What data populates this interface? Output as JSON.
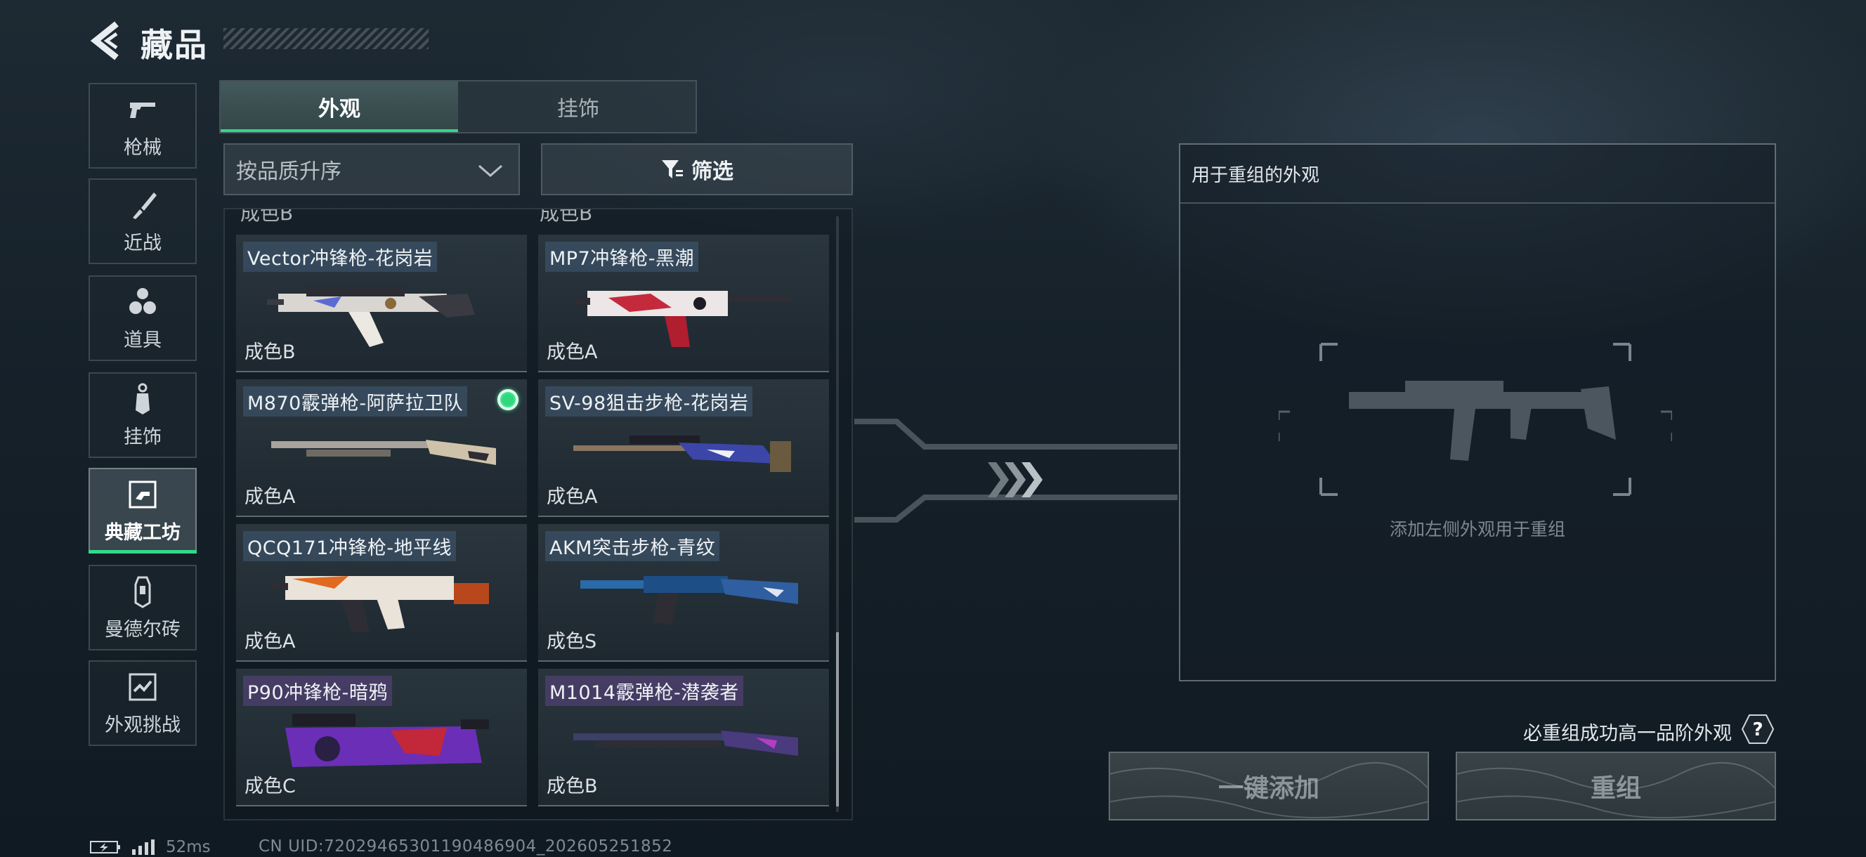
{
  "header": {
    "title": "藏品"
  },
  "categories": [
    {
      "label": "枪械",
      "icon": "pistol-icon",
      "active": false
    },
    {
      "label": "近战",
      "icon": "knife-icon",
      "active": false
    },
    {
      "label": "道具",
      "icon": "grenades-icon",
      "active": false
    },
    {
      "label": "挂饰",
      "icon": "charm-icon",
      "active": false
    },
    {
      "label": "典藏工坊",
      "icon": "workshop-icon",
      "active": true
    },
    {
      "label": "曼德尔砖",
      "icon": "mandel-brick-icon",
      "active": false
    },
    {
      "label": "外观挑战",
      "icon": "challenge-icon",
      "active": false
    }
  ],
  "tabs": [
    {
      "label": "外观",
      "active": true
    },
    {
      "label": "挂饰",
      "active": false
    }
  ],
  "sort": {
    "value": "按品质升序"
  },
  "filter": {
    "label": "筛选",
    "icon": "filter-icon"
  },
  "items": [
    {
      "name": "Vector冲锋枪-花岗岩",
      "grade": "成色B",
      "equipped": false,
      "tint": "blue"
    },
    {
      "name": "MP7冲锋枪-黑潮",
      "grade": "成色A",
      "equipped": false,
      "tint": "blue"
    },
    {
      "name": "M870霰弹枪-阿萨拉卫队",
      "grade": "成色A",
      "equipped": true,
      "tint": "blue"
    },
    {
      "name": "SV-98狙击步枪-花岗岩",
      "grade": "成色A",
      "equipped": false,
      "tint": "blue"
    },
    {
      "name": "QCQ171冲锋枪-地平线",
      "grade": "成色A",
      "equipped": false,
      "tint": "blue"
    },
    {
      "name": "AKM突击步枪-青纹",
      "grade": "成色S",
      "equipped": false,
      "tint": "blue"
    },
    {
      "name": "P90冲锋枪-暗鸦",
      "grade": "成色C",
      "equipped": false,
      "tint": "purple"
    },
    {
      "name": "M1014霰弹枪-潜袭者",
      "grade": "成色B",
      "equipped": false,
      "tint": "purple"
    }
  ],
  "cut_row": {
    "left": "成色B",
    "right": "成色B"
  },
  "panel": {
    "title": "用于重组的外观",
    "placeholder": "添加左侧外观用于重组"
  },
  "guarantee_text": "必重组成功高一品阶外观",
  "help_label": "?",
  "buttons": {
    "quick_add": "一键添加",
    "reassemble": "重组"
  },
  "status": {
    "ping": "52ms",
    "uid": "CN UID:72029465301190486904_202605251852"
  },
  "colors": {
    "accent": "#31d98a",
    "equipped": "#3fe08e"
  }
}
